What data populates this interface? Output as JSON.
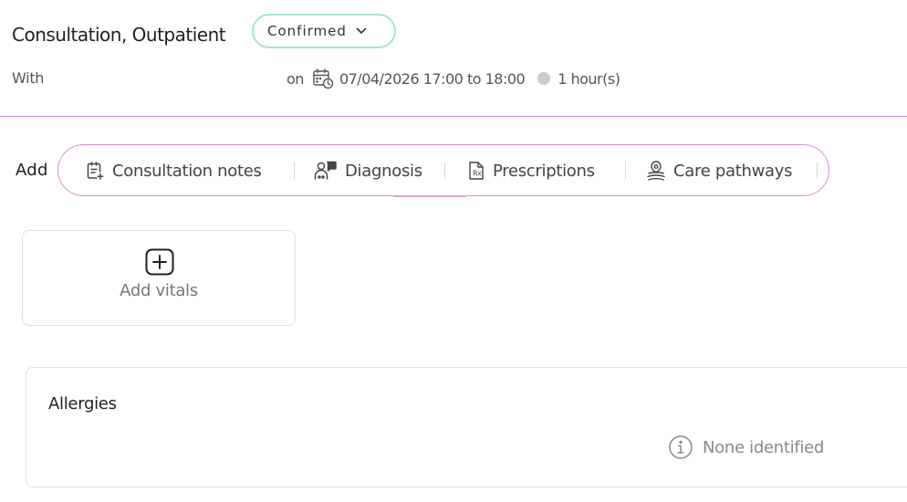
{
  "appointment": {
    "title": "Consultation, Outpatient",
    "status": "Confirmed",
    "with_label": "With",
    "on_label": "on",
    "datetime": "07/04/2026 17:00 to 18:00",
    "duration": "1 hour(s)"
  },
  "add_bar": {
    "label": "Add",
    "items": [
      {
        "label": "Consultation notes",
        "icon": "note-add-icon"
      },
      {
        "label": "Diagnosis",
        "icon": "doctor-patient-icon"
      },
      {
        "label": "Prescriptions",
        "icon": "prescription-icon"
      },
      {
        "label": "Care pathways",
        "icon": "care-pathway-icon"
      }
    ]
  },
  "vitals": {
    "add_label": "Add vitals"
  },
  "allergies": {
    "title": "Allergies",
    "status": "None identified"
  },
  "colors": {
    "status_border": "#a6e3d4",
    "accent_border": "#d98fd9",
    "card_border": "#e0e0e0",
    "muted_text": "#888888"
  }
}
